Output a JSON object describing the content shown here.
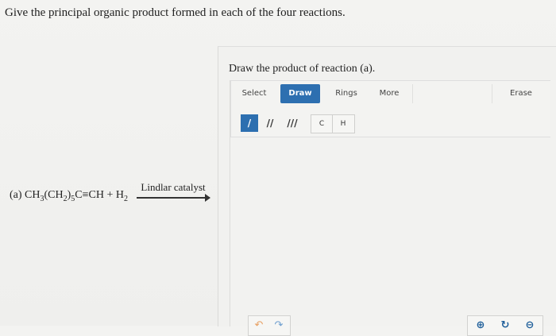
{
  "question": "Give the principal organic product formed in each of the four reactions.",
  "reaction_a": {
    "label": "(a)",
    "catalyst": "Lindlar catalyst"
  },
  "panel": {
    "prompt": "Draw the product of reaction (a).",
    "tabs": {
      "select": "Select",
      "draw": "Draw",
      "rings": "Rings",
      "more": "More",
      "erase": "Erase"
    },
    "bond_tools": {
      "single": "/",
      "double": "//",
      "triple": "///"
    },
    "atoms": {
      "c": "C",
      "h": "H"
    }
  },
  "icons": {
    "undo": "undo-icon",
    "redo": "redo-icon",
    "zoom_in": "zoom-in-icon",
    "zoom_reset": "zoom-reset-icon",
    "zoom_out": "zoom-out-icon"
  },
  "colors": {
    "accent": "#2d6fb0",
    "background": "#f1f1ef"
  }
}
